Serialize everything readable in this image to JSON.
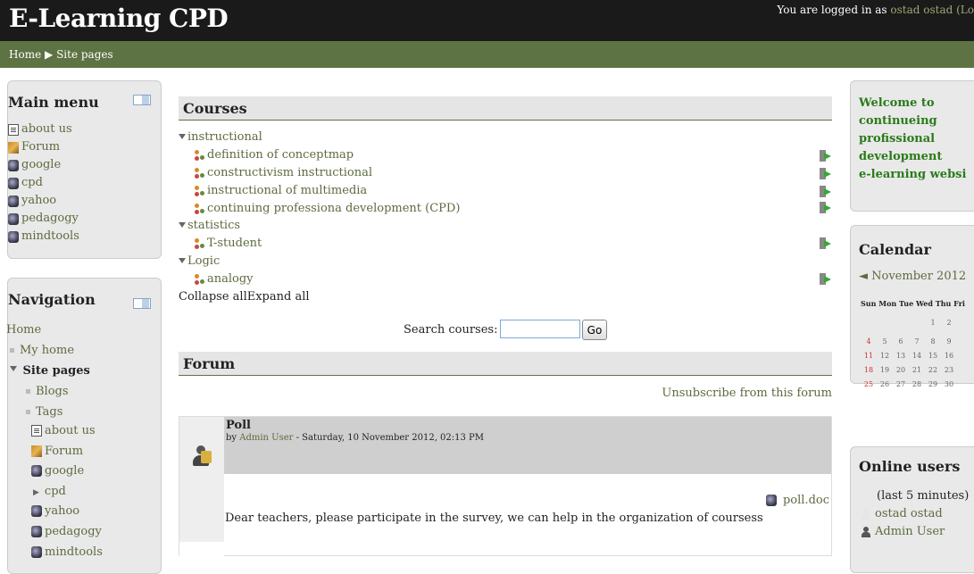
{
  "header": {
    "site_title": "E-Learning CPD",
    "login_text": "You are logged in as ",
    "login_user": "ostad ostad",
    "logout_text": "(Lo"
  },
  "breadcrumb": {
    "home": "Home",
    "sep": "▶",
    "current": "Site pages"
  },
  "main_menu": {
    "title": "Main menu",
    "items": [
      {
        "label": "about us",
        "icon": "page-icon"
      },
      {
        "label": "Forum",
        "icon": "forum-icon"
      },
      {
        "label": "google",
        "icon": "url-icon"
      },
      {
        "label": "cpd",
        "icon": "url-icon"
      },
      {
        "label": "yahoo",
        "icon": "url-icon"
      },
      {
        "label": "pedagogy",
        "icon": "url-icon"
      },
      {
        "label": "mindtools",
        "icon": "url-icon"
      }
    ]
  },
  "navigation": {
    "title": "Navigation",
    "home": "Home",
    "my_home": "My home",
    "site_pages": "Site pages",
    "blogs": "Blogs",
    "tags": "Tags",
    "items": [
      "about us",
      "Forum",
      "google",
      "cpd",
      "yahoo",
      "pedagogy",
      "mindtools"
    ]
  },
  "courses": {
    "title": "Courses",
    "categories": [
      {
        "name": "instructional",
        "courses": [
          "definition of conceptmap",
          "constructivism instructional",
          "instructional of multimedia",
          "continuing professiona development (CPD)"
        ]
      },
      {
        "name": "statistics",
        "courses": [
          "T-student"
        ]
      },
      {
        "name": "Logic",
        "courses": [
          "analogy"
        ]
      }
    ],
    "collapse_all": "Collapse all",
    "expand_all": "Expand all",
    "search_label": "Search courses:",
    "search_value": "",
    "go_label": "Go"
  },
  "forum": {
    "title": "Forum",
    "unsubscribe": "Unsubscribe from this forum",
    "post": {
      "subject": "Poll",
      "by": "by ",
      "author": "Admin User",
      "date": " - Saturday, 10 November 2012, 02:13 PM",
      "attachment": "poll.doc",
      "message": "Dear teachers, please participate in the survey, we can help in the organization of coursess"
    }
  },
  "welcome": {
    "lines": [
      "Welcome to",
      "continueing",
      "profissional",
      "development",
      "e-learning websi"
    ]
  },
  "calendar": {
    "title": "Calendar",
    "month": "◄ November 2012",
    "days": [
      "Sun",
      "Mon",
      "Tue",
      "Wed",
      "Thu",
      "Fri"
    ],
    "weeks": [
      [
        "",
        "",
        "",
        "",
        "1",
        "2"
      ],
      [
        "4",
        "5",
        "6",
        "7",
        "8",
        "9"
      ],
      [
        "11",
        "12",
        "13",
        "14",
        "15",
        "16"
      ],
      [
        "18",
        "19",
        "20",
        "21",
        "22",
        "23"
      ],
      [
        "25",
        "26",
        "27",
        "28",
        "29",
        "30"
      ]
    ]
  },
  "online": {
    "title": "Online users",
    "subtitle": "(last 5 minutes)",
    "users": [
      "ostad ostad",
      "Admin User"
    ]
  }
}
